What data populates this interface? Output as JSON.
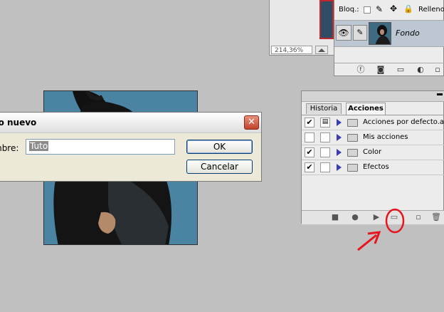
{
  "navigator": {
    "zoom": "214,36%"
  },
  "layers": {
    "lock_label": "Bloq.:",
    "fill_label": "Relleno:",
    "layer_name": "Fondo",
    "icons": [
      "eye-icon",
      "brush-icon",
      "link-icon",
      "fx-icon",
      "mask-icon",
      "folder-icon",
      "adjustment-icon",
      "new-layer-icon"
    ]
  },
  "dialog": {
    "title": "po nuevo",
    "name_label": "mbre:",
    "name_value": "Tuto",
    "ok_label": "OK",
    "cancel_label": "Cancelar",
    "close_glyph": "✕"
  },
  "actions_panel": {
    "tabs": [
      "Historia",
      "Acciones"
    ],
    "active_tab": "Acciones",
    "items": [
      {
        "label": "Acciones por defecto.atn",
        "checked": true
      },
      {
        "label": "Mis acciones",
        "checked": false
      },
      {
        "label": "Color",
        "checked": true
      },
      {
        "label": "Efectos",
        "checked": true
      }
    ],
    "footer_icons": [
      "stop-icon",
      "record-icon",
      "play-icon",
      "new-set-icon",
      "new-action-icon",
      "delete-icon"
    ]
  },
  "colors": {
    "annotation": "#e8141e",
    "selection": "#8c8c8c",
    "dialog_bg": "#ece9d8",
    "expand_triangle": "#3b3bb8"
  }
}
